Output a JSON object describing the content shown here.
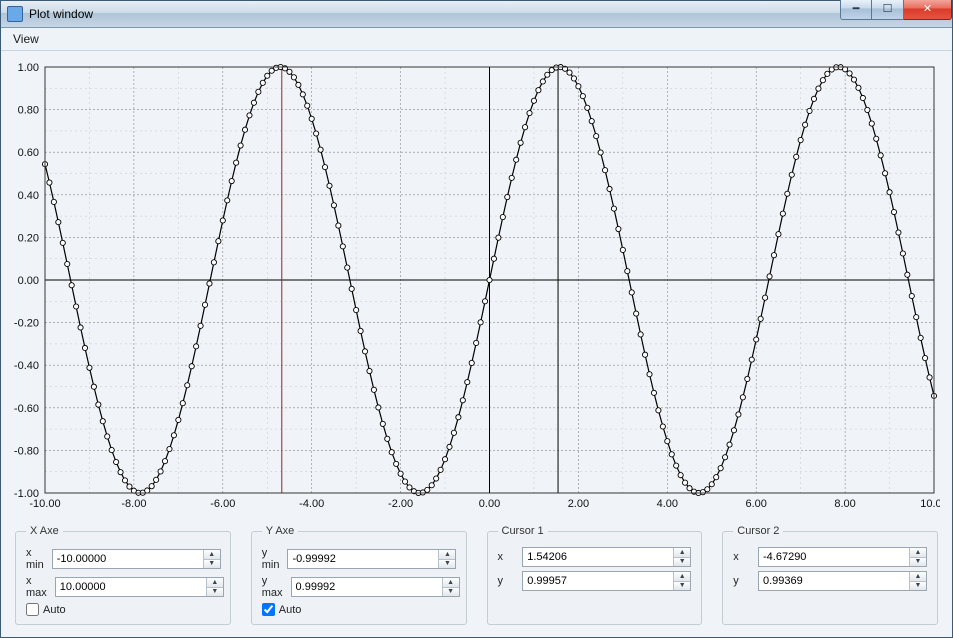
{
  "window": {
    "title": "Plot window"
  },
  "menu": {
    "view": "View"
  },
  "panels": {
    "xaxe": {
      "legend": "X Axe",
      "min_label": "x min",
      "min_value": "-10.00000",
      "max_label": "x max",
      "max_value": "10.00000",
      "auto_label": "Auto",
      "auto_checked": false
    },
    "yaxe": {
      "legend": "Y Axe",
      "min_label": "y min",
      "min_value": "-0.99992",
      "max_label": "y max",
      "max_value": "0.99992",
      "auto_label": "Auto",
      "auto_checked": true
    },
    "cursor1": {
      "legend": "Cursor 1",
      "x_label": "x",
      "x_value": "1.54206",
      "y_label": "y",
      "y_value": "0.99957"
    },
    "cursor2": {
      "legend": "Cursor 2",
      "x_label": "x",
      "x_value": "-4.67290",
      "y_label": "y",
      "y_value": "0.99369"
    }
  },
  "chart_data": {
    "type": "line",
    "title": "",
    "xlabel": "",
    "ylabel": "",
    "xlim": [
      -10,
      10
    ],
    "ylim": [
      -1,
      1
    ],
    "x_ticks": [
      "-10.00",
      "-8.00",
      "-6.00",
      "-4.00",
      "-2.00",
      "0.00",
      "2.00",
      "4.00",
      "6.00",
      "8.00",
      "10.00"
    ],
    "y_ticks": [
      "-1.00",
      "-0.80",
      "-0.60",
      "-0.40",
      "-0.20",
      "0.00",
      "0.20",
      "0.40",
      "0.60",
      "0.80",
      "1.00"
    ],
    "function": "sin(x)",
    "n_points": 201,
    "cursors": [
      {
        "name": "Cursor 1",
        "x": 1.54206,
        "y": 0.99957,
        "color": "#000000"
      },
      {
        "name": "Cursor 2",
        "x": -4.6729,
        "y": 0.99369,
        "color": "#8a2a2a"
      }
    ],
    "series": [
      {
        "name": "sin(x)",
        "formula": "sin(x)"
      }
    ]
  }
}
